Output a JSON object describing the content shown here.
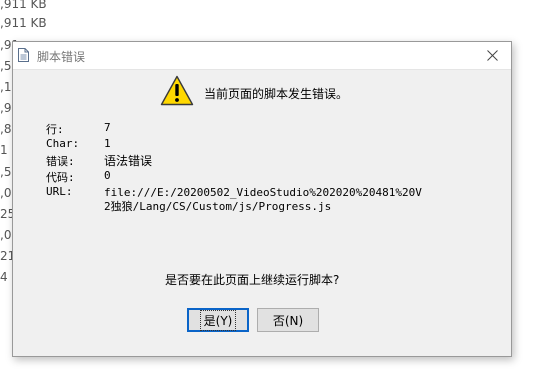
{
  "background": {
    "rows": [
      ",911 KB",
      ",911 KB",
      ",91",
      ",54",
      ",14",
      ",92",
      ",84",
      "1",
      ",56",
      ",03",
      "25",
      ",05",
      "21",
      "4"
    ]
  },
  "dialog": {
    "title": "脚本错误",
    "message": "当前页面的脚本发生错误。",
    "fields": {
      "line_label": "行:",
      "line_value": "7",
      "char_label": "Char:",
      "char_value": "1",
      "error_label": "错误:",
      "error_value": "语法错误",
      "code_label": "代码:",
      "code_value": "0",
      "url_label": "URL:",
      "url_value": "file:///E:/20200502_VideoStudio%202020%20481%20V2独狼/Lang/CS/Custom/js/Progress.js"
    },
    "question": "是否要在此页面上继续运行脚本?",
    "buttons": {
      "yes": "是(Y)",
      "no": "否(N)"
    },
    "icons": {
      "title": "document-icon",
      "warning": "warning-icon",
      "close": "close-icon"
    },
    "colors": {
      "dialog_bg": "#f0f0f0",
      "warning_fill": "#ffd800",
      "default_button_border": "#0a64c8"
    }
  }
}
